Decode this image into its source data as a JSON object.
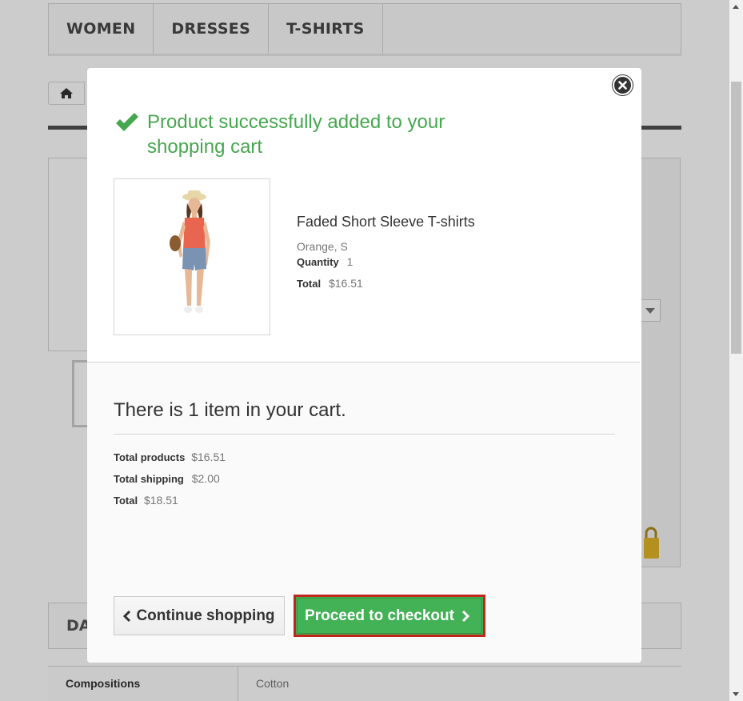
{
  "nav": {
    "items": [
      "WOMEN",
      "DRESSES",
      "T-SHIRTS"
    ]
  },
  "background": {
    "datasheet_label": "DA",
    "table": {
      "label": "Compositions",
      "value": "Cotton"
    }
  },
  "modal": {
    "success_message": "Product successfully added to your shopping cart",
    "product": {
      "name": "Faded Short Sleeve T-shirts",
      "attributes": "Orange, S",
      "quantity_label": "Quantity",
      "quantity": "1",
      "total_label": "Total",
      "total": "$16.51"
    },
    "cart": {
      "count_text": "There is 1 item in your cart.",
      "total_products_label": "Total products",
      "total_products": "$16.51",
      "total_shipping_label": "Total shipping",
      "total_shipping": "$2.00",
      "total_label": "Total",
      "total": "$18.51"
    },
    "buttons": {
      "continue": "Continue shopping",
      "checkout": "Proceed to checkout"
    }
  },
  "colors": {
    "success_green": "#46a74e",
    "checkout_green": "#43b155",
    "highlight_red": "#c0261d",
    "overlay": "rgba(0,0,0,0.2)"
  },
  "icons": {
    "home": "home-icon",
    "close": "close-icon",
    "check": "check-icon",
    "chevron_left": "chevron-left-icon",
    "chevron_right": "chevron-right-icon"
  }
}
